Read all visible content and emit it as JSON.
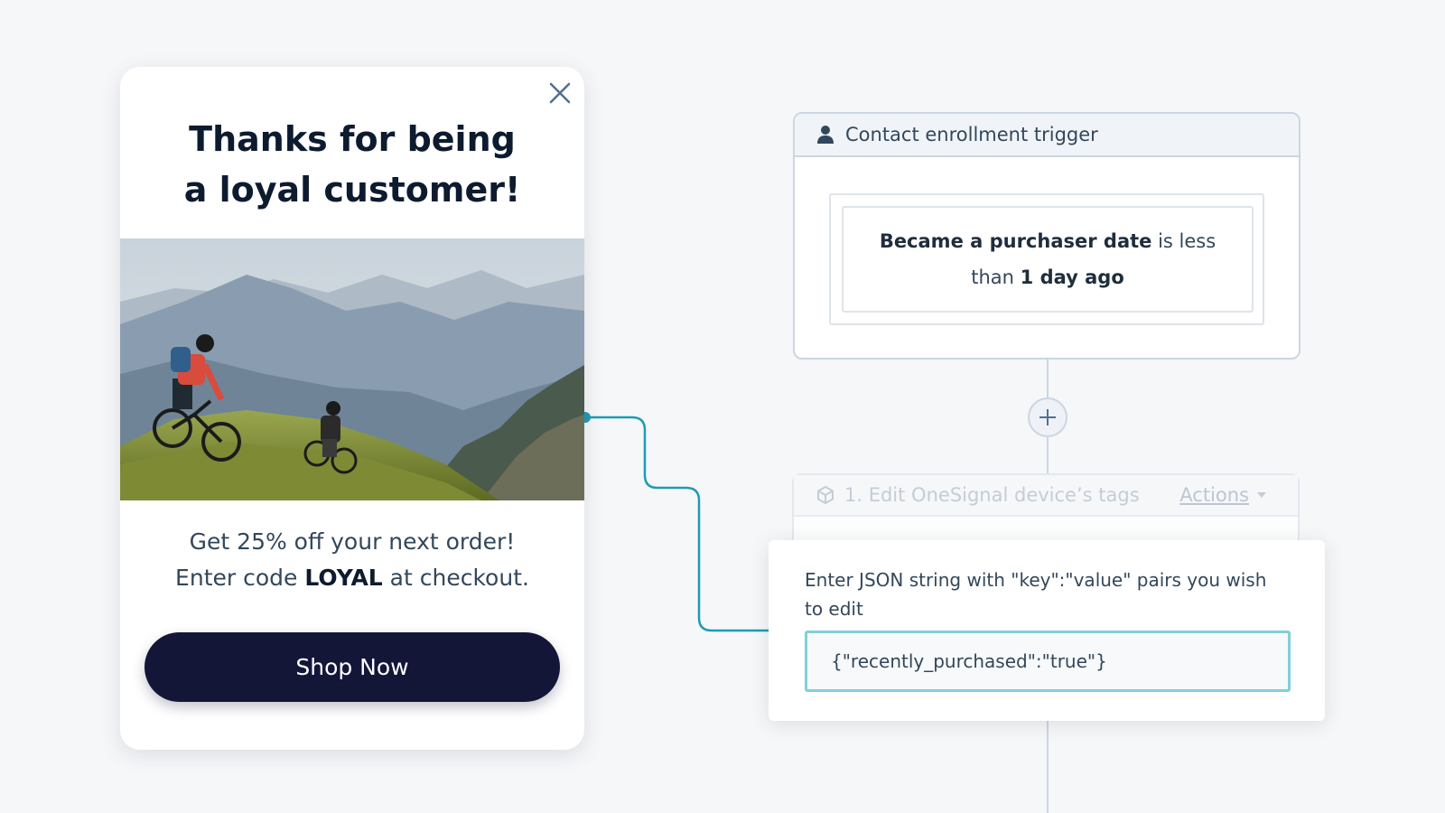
{
  "popup": {
    "title_line1": "Thanks for being",
    "title_line2": "a loyal customer!",
    "offer_line1": "Get 25% off your next order!",
    "offer_line2_prefix": "Enter code ",
    "offer_code": "LOYAL",
    "offer_line2_suffix": " at checkout.",
    "cta_label": "Shop Now",
    "close_icon": "close-icon",
    "image": "mountain-bikers-photo"
  },
  "workflow": {
    "trigger": {
      "icon": "contact-icon",
      "header": "Contact enrollment trigger",
      "condition_property": "Became a purchaser date",
      "condition_operator": " is less than ",
      "condition_value": "1 day ago"
    },
    "add_step_icon": "plus-icon",
    "action": {
      "icon": "cube-icon",
      "title": "1. Edit OneSignal device’s tags",
      "actions_label": "Actions",
      "dropdown_icon": "caret-down-icon"
    },
    "json_panel": {
      "label": "Enter JSON string with \"key\":\"value\" pairs you wish to edit",
      "value": "{\"recently_purchased\":\"true\"}"
    }
  },
  "colors": {
    "background": "#f6f7f9",
    "button_navy": "#141638",
    "connector_teal": "#1e9bb5",
    "input_focus": "#7fd1d8",
    "border": "#cbd6e2"
  }
}
